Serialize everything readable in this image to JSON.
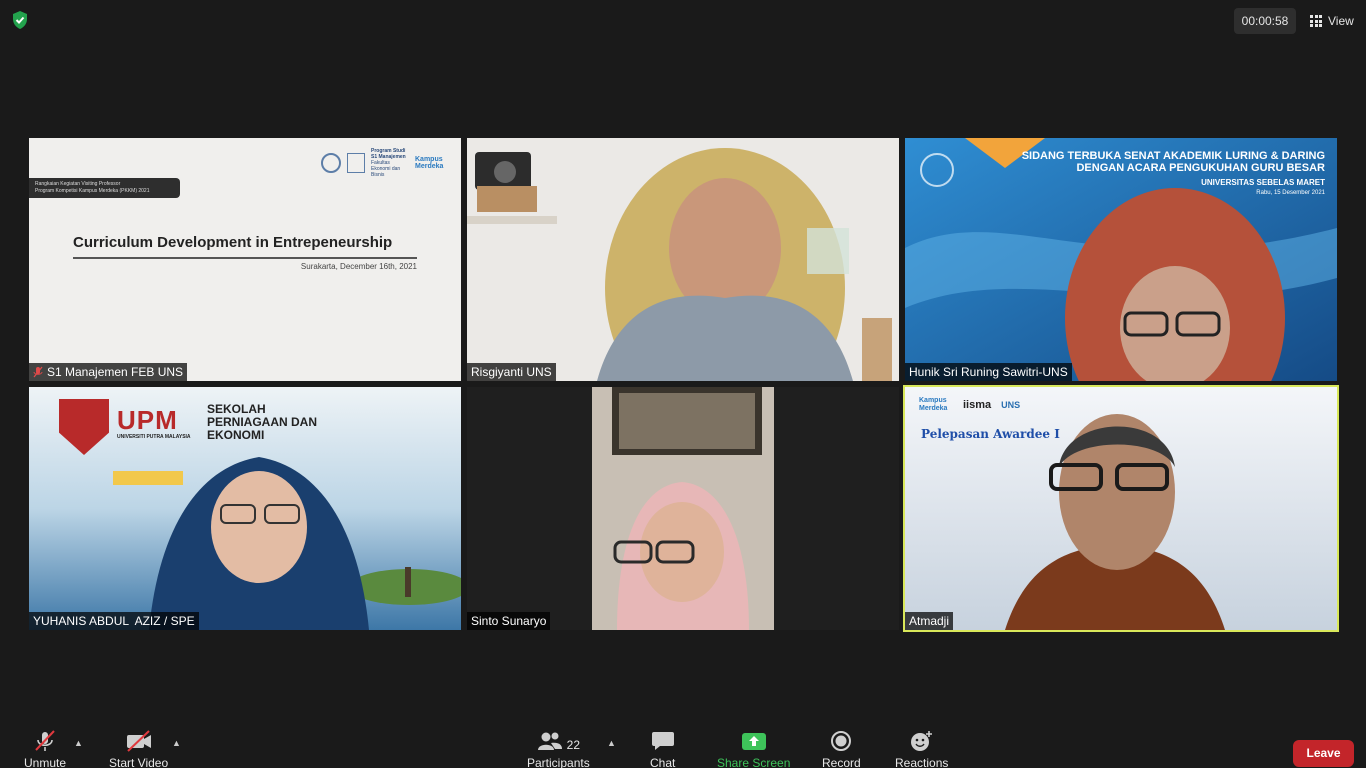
{
  "timer": "00:00:58",
  "view_label": "View",
  "tiles": [
    {
      "name": "S1 Manajemen FEB UNS",
      "muted": true,
      "slide": {
        "badge_line1": "Rangkaian Kegiatan Visiting Professor",
        "badge_line2": "Program Kompetisi Kampus Merdeka (PKKM) 2021",
        "title": "Curriculum Development in Entrepeneurship",
        "date": "Surakarta, December 16th, 2021",
        "logo_text": "Program Studi S1 Manajemen",
        "logo_sub": "Fakultas Ekonomi dan Bisnis",
        "km_logo": "Kampus Merdeka"
      }
    },
    {
      "name": "Risgiyanti UNS"
    },
    {
      "name": "Hunik Sri Runing Sawitri-UNS",
      "bg": {
        "line1": "SIDANG TERBUKA SENAT AKADEMIK LURING & DARING",
        "line2": "DENGAN ACARA PENGUKUHAN GURU BESAR",
        "line3": "UNIVERSITAS SEBELAS MARET",
        "line4": "Rabu, 15 Desember 2021"
      }
    },
    {
      "name": "YUHANIS ABDUL  AZIZ / SPE",
      "bg": {
        "upm": "UPM",
        "upm_sub": "UNIVERSITI PUTRA MALAYSIA",
        "sekolah1": "SEKOLAH",
        "sekolah2": "PERNIAGAAN DAN",
        "sekolah3": "EKONOMI"
      }
    },
    {
      "name": "Sinto Sunaryo"
    },
    {
      "name": "Atmadji",
      "bg": {
        "km": "Kampus Merdeka",
        "iisma": "iisma",
        "uns": "UNS",
        "title": "Pelepasan Awardee I"
      }
    }
  ],
  "toolbar": {
    "unmute": "Unmute",
    "start_video": "Start Video",
    "participants": "Participants",
    "participants_count": "22",
    "chat": "Chat",
    "share_screen": "Share Screen",
    "record": "Record",
    "reactions": "Reactions",
    "leave": "Leave"
  },
  "colors": {
    "background": "#1a1a1a",
    "share_green": "#3ec35a",
    "leave_red": "#c3252a",
    "active_speaker": "#d9e85a"
  }
}
